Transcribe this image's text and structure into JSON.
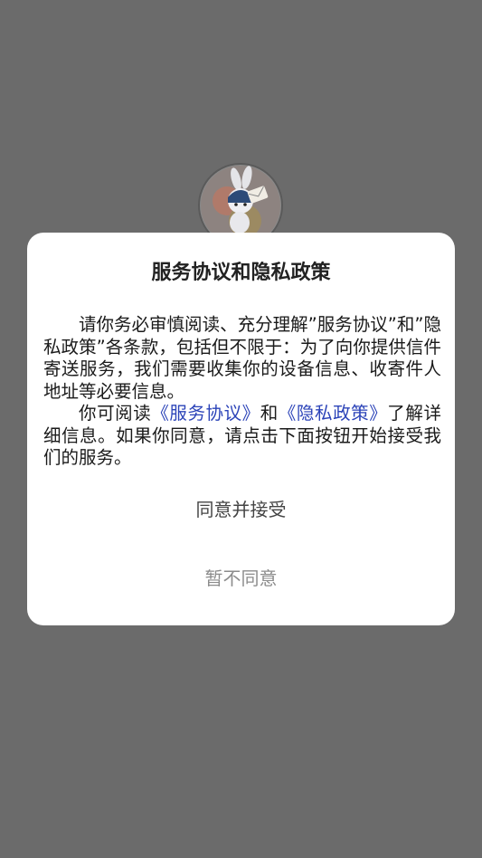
{
  "dialog": {
    "title": "服务协议和隐私政策",
    "para1": "请你务必审慎阅读、充分理解”服务协议”和”隐私政策”各条款，包括但不限于：为了向你提供信件寄送服务，我们需要收集你的设备信息、收寄件人地址等必要信息。",
    "para2_prefix": "你可阅读",
    "service_link": "《服务协议》",
    "para2_and": "和",
    "privacy_link": "《隐私政策》",
    "para2_suffix": "了解详细信息。如果你同意，请点击下面按钮开始接受我们的服务。",
    "agree_label": "同意并接受",
    "decline_label": "暂不同意"
  },
  "colors": {
    "overlay": "#6b6b6b",
    "dialog_bg": "#ffffff",
    "link": "#2b43b8",
    "decline_text": "#8c8c8c"
  },
  "icons": {
    "mascot": "rabbit-mascot-with-letter"
  }
}
